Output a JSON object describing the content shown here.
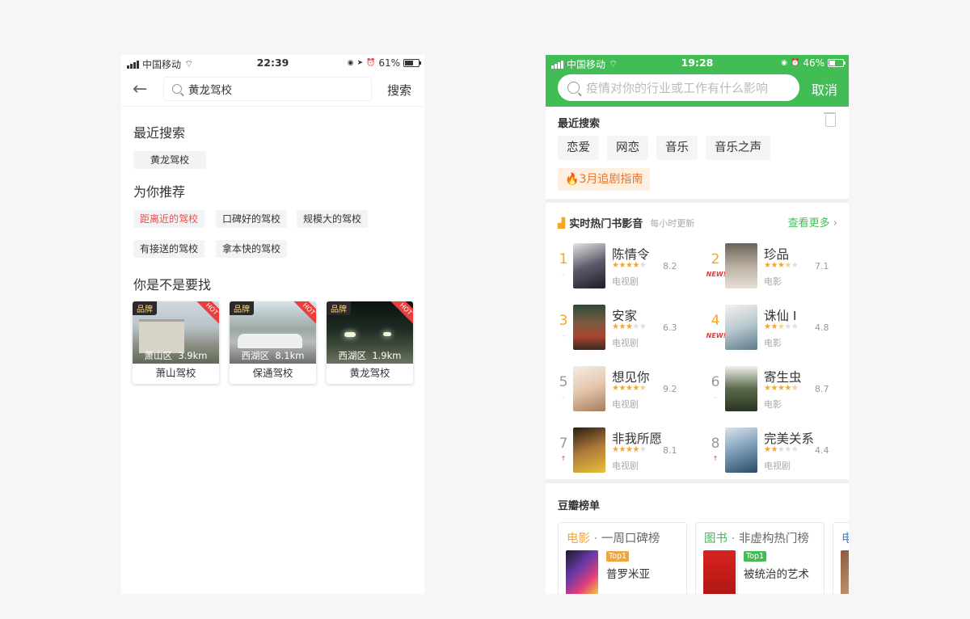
{
  "left_phone": {
    "status": {
      "carrier": "中国移动",
      "time": "22:39",
      "battery": "61%",
      "battery_level": 0.61
    },
    "search": {
      "query": "黄龙驾校",
      "button": "搜索"
    },
    "recent": {
      "title": "最近搜索",
      "tags": [
        "黄龙驾校"
      ]
    },
    "recommend": {
      "title": "为你推荐",
      "tags": [
        "距离近的驾校",
        "口碑好的驾校",
        "规模大的驾校",
        "有接送的驾校",
        "拿本快的驾校"
      ]
    },
    "guess": {
      "title": "你是不是要找",
      "badge": "品牌",
      "hot": "HOT",
      "cards": [
        {
          "district": "萧山区",
          "distance": "3.9km",
          "name": "萧山驾校"
        },
        {
          "district": "西湖区",
          "distance": "8.1km",
          "name": "保通驾校"
        },
        {
          "district": "西湖区",
          "distance": "1.9km",
          "name": "黄龙驾校"
        }
      ]
    }
  },
  "right_phone": {
    "status": {
      "carrier": "中国移动",
      "time": "19:28",
      "battery": "46%",
      "battery_level": 0.46
    },
    "search": {
      "placeholder": "疫情对你的行业或工作有什么影响",
      "cancel": "取消"
    },
    "recent": {
      "title": "最近搜索",
      "tags": [
        "恋爱",
        "网恋",
        "音乐",
        "音乐之声"
      ],
      "guide": "3月追剧指南"
    },
    "hot": {
      "title": "实时热门书影音",
      "subtitle": "每小时更新",
      "more": "查看更多",
      "items": [
        {
          "rank": "1",
          "mark": "–",
          "title": "陈情令",
          "score": "8.2",
          "stars": 4,
          "type": "电视剧"
        },
        {
          "rank": "2",
          "mark": "NEW!",
          "title": "珍品",
          "score": "7.1",
          "stars": 3.5,
          "type": "电影"
        },
        {
          "rank": "3",
          "mark": "–",
          "title": "安家",
          "score": "6.3",
          "stars": 3,
          "type": "电视剧"
        },
        {
          "rank": "4",
          "mark": "NEW!",
          "title": "诛仙 I",
          "score": "4.8",
          "stars": 2.5,
          "type": "电影"
        },
        {
          "rank": "5",
          "mark": "–",
          "title": "想见你",
          "score": "9.2",
          "stars": 4.5,
          "type": "电视剧"
        },
        {
          "rank": "6",
          "mark": "–",
          "title": "寄生虫",
          "score": "8.7",
          "stars": 4.5,
          "type": "电影"
        },
        {
          "rank": "7",
          "mark": "↑",
          "title": "非我所愿",
          "score": "8.1",
          "stars": 4,
          "type": "电视剧"
        },
        {
          "rank": "8",
          "mark": "↑",
          "title": "完美关系",
          "score": "4.4",
          "stars": 2,
          "type": "电视剧"
        }
      ]
    },
    "charts": {
      "title": "豆瓣榜单",
      "cards": [
        {
          "cat": "电影",
          "sep": "·",
          "sub": "一周口碑榜",
          "badge": "Top1",
          "title": "普罗米亚"
        },
        {
          "cat": "图书",
          "sep": "·",
          "sub": "非虚构热门榜",
          "badge": "Top1",
          "title": "被统治的艺术"
        },
        {
          "cat": "电",
          "sep": "",
          "sub": "",
          "badge": "",
          "title": ""
        }
      ]
    }
  },
  "colors": {
    "green": "#42bd56",
    "red": "#ee4d4d",
    "gold": "#f5a623",
    "orange": "#e8742c",
    "movie": "#f4a53a",
    "book": "#42bd56",
    "tv": "#4a7fd8"
  }
}
